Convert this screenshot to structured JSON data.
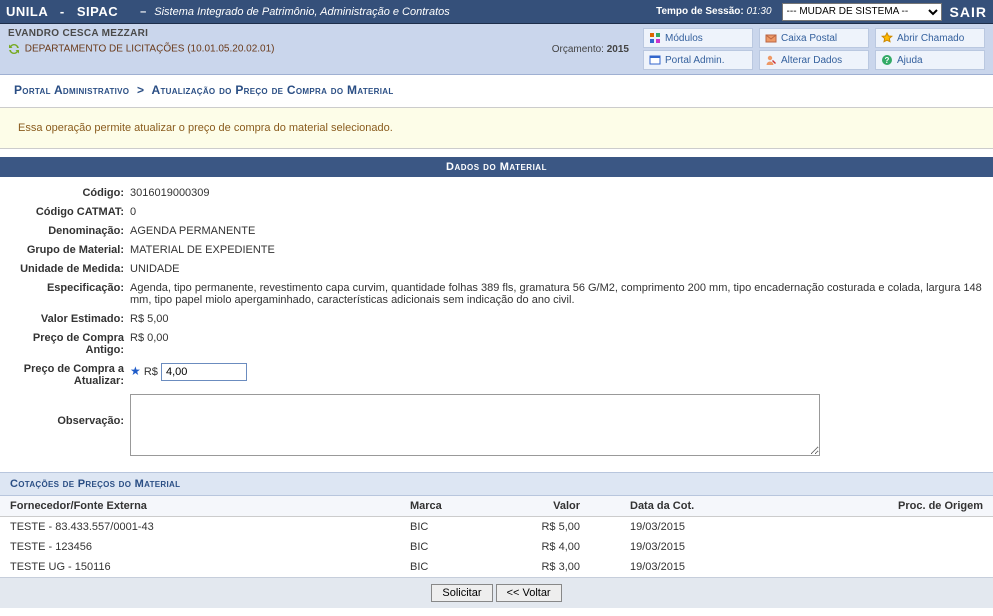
{
  "topbar": {
    "app": "UNILA",
    "module": "SIPAC",
    "subtitle": "Sistema Integrado de Patrimônio, Administração e Contratos",
    "session_label": "Tempo de Sessão:",
    "session_time": "01:30",
    "system_select": "--- MUDAR DE SISTEMA --",
    "exit": "SAIR"
  },
  "subbar": {
    "user": "EVANDRO CESCA MEZZARI",
    "dept": "DEPARTAMENTO DE LICITAÇÕES (10.01.05.20.02.01)",
    "orcamento_label": "Orçamento:",
    "orcamento_year": "2015",
    "menu": {
      "modulos": "Módulos",
      "caixa": "Caixa Postal",
      "abrir": "Abrir Chamado",
      "portal": "Portal Admin.",
      "alterar": "Alterar Dados",
      "ajuda": "Ajuda"
    }
  },
  "breadcrumb": {
    "a": "Portal Administrativo",
    "sep": ">",
    "b": "Atualização do Preço de Compra do Material"
  },
  "info": "Essa operação permite atualizar o preço de compra do material selecionado.",
  "section_header": "Dados do Material",
  "fields": {
    "codigo": {
      "label": "Código:",
      "value": "3016019000309"
    },
    "catmat": {
      "label": "Código CATMAT:",
      "value": "0"
    },
    "denom": {
      "label": "Denominação:",
      "value": "AGENDA PERMANENTE"
    },
    "grupo": {
      "label": "Grupo de Material:",
      "value": "MATERIAL DE EXPEDIENTE"
    },
    "unidade": {
      "label": "Unidade de Medida:",
      "value": "UNIDADE"
    },
    "espec": {
      "label": "Especificação:",
      "value": "Agenda, tipo permanente, revestimento capa curvim, quantidade folhas 389 fls, gramatura 56 G/M2, comprimento 200 mm, tipo encadernação costurada e colada, largura 148 mm, tipo papel miolo apergaminhado, características adicionais sem indicação do ano civil."
    },
    "valest": {
      "label": "Valor Estimado:",
      "value": "R$ 5,00"
    },
    "antigo": {
      "label": "Preço de Compra Antigo:",
      "value": "R$ 0,00"
    },
    "atualizar": {
      "label": "Preço de Compra a Atualizar:",
      "currency": "R$",
      "value": "4,00"
    },
    "obs": {
      "label": "Observação:"
    }
  },
  "quot": {
    "header": "Cotações de Preços do Material",
    "cols": {
      "fornecedor": "Fornecedor/Fonte Externa",
      "marca": "Marca",
      "valor": "Valor",
      "data": "Data da Cot.",
      "proc": "Proc. de Origem"
    },
    "rows": [
      {
        "fornecedor": "TESTE - 83.433.557/0001-43",
        "marca": "BIC",
        "valor": "R$ 5,00",
        "data": "19/03/2015",
        "proc": ""
      },
      {
        "fornecedor": "TESTE - 123456",
        "marca": "BIC",
        "valor": "R$ 4,00",
        "data": "19/03/2015",
        "proc": ""
      },
      {
        "fornecedor": "TESTE UG - 150116",
        "marca": "BIC",
        "valor": "R$ 3,00",
        "data": "19/03/2015",
        "proc": ""
      }
    ]
  },
  "buttons": {
    "solicitar": "Solicitar",
    "voltar": "<< Voltar"
  }
}
